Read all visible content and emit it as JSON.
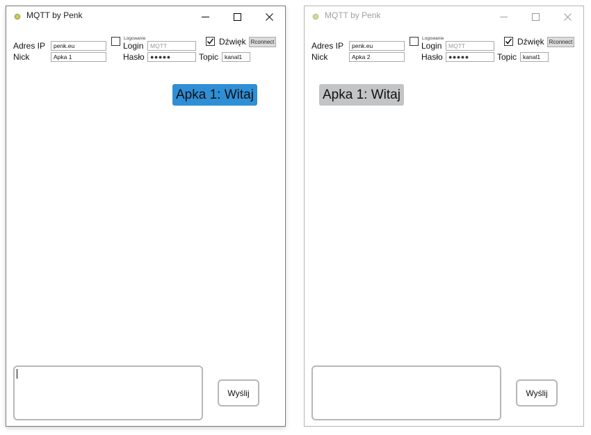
{
  "windows": [
    {
      "title": "MQTT by Penk",
      "state": "active",
      "labels": {
        "ip": "Adres IP",
        "nick": "Nick",
        "login_caption": "Logowanie",
        "login": "Login",
        "password": "Hasło",
        "sound": "Dźwięk",
        "topic": "Topic"
      },
      "fields": {
        "ip_value": "penk.eu",
        "nick_value": "Apka 1",
        "login_placeholder": "MQTT",
        "password_masked": "●●●●●",
        "topic_value": "kanal1",
        "message_value": ""
      },
      "checkboxes": {
        "login_checked": false,
        "sound_checked": true
      },
      "buttons": {
        "reconnect": "Rconnect",
        "send": "Wyślij"
      },
      "messages": [
        {
          "text": "Apka 1: Witaj",
          "own": true
        }
      ]
    },
    {
      "title": "MQTT by Penk",
      "state": "inactive",
      "labels": {
        "ip": "Adres IP",
        "nick": "Nick",
        "login_caption": "Logowanie",
        "login": "Login",
        "password": "Hasło",
        "sound": "Dźwięk",
        "topic": "Topic"
      },
      "fields": {
        "ip_value": "penk.eu",
        "nick_value": "Apka 2",
        "login_placeholder": "MQTT",
        "password_masked": "●●●●●",
        "topic_value": "kanal1",
        "message_value": ""
      },
      "checkboxes": {
        "login_checked": false,
        "sound_checked": true
      },
      "buttons": {
        "reconnect": "Rconnect",
        "send": "Wyślij"
      },
      "messages": [
        {
          "text": "Apka 1: Witaj",
          "own": false
        }
      ]
    }
  ],
  "colors": {
    "own_bubble": "#2f8fd6",
    "other_bubble": "#c2c4c6"
  }
}
